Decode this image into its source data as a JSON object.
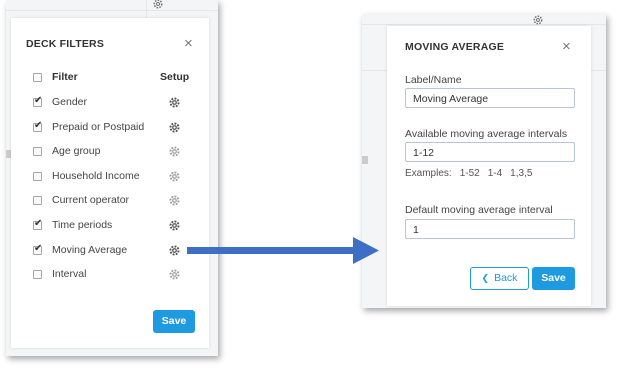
{
  "left_panel": {
    "title": "DECK FILTERS",
    "close": "×",
    "header": {
      "filter_label": "Filter",
      "setup_label": "Setup"
    },
    "rows": [
      {
        "label": "Gender",
        "checked": true
      },
      {
        "label": "Prepaid or Postpaid",
        "checked": true
      },
      {
        "label": "Age group",
        "checked": false
      },
      {
        "label": "Household Income",
        "checked": false
      },
      {
        "label": "Current operator",
        "checked": false
      },
      {
        "label": "Time periods",
        "checked": true
      },
      {
        "label": "Moving Average",
        "checked": true
      },
      {
        "label": "Interval",
        "checked": false
      }
    ],
    "save_label": "Save"
  },
  "right_panel": {
    "title": "MOVING AVERAGE",
    "close": "×",
    "label_name": {
      "label": "Label/Name",
      "value": "Moving Average"
    },
    "intervals": {
      "label": "Available moving average intervals",
      "value": "1-12",
      "examples_label": "Examples:",
      "examples": [
        "1-52",
        "1-4",
        "1,3,5"
      ]
    },
    "default_interval": {
      "label": "Default moving average interval",
      "value": "1"
    },
    "back_label": "Back",
    "back_icon": "chevron-left-icon",
    "save_label": "Save"
  },
  "colors": {
    "accent": "#1e9ae0",
    "arrow": "#3d6fc4",
    "gear_dark": "#555555",
    "gear_light": "#a0a0a0"
  }
}
